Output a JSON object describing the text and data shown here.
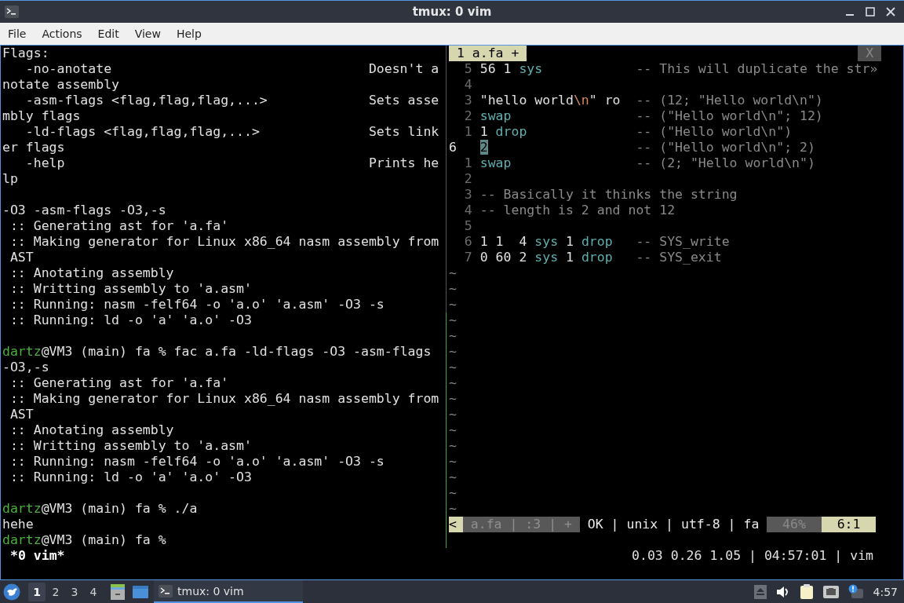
{
  "window": {
    "title": "tmux: 0 vim"
  },
  "menu": [
    "File",
    "Actions",
    "Edit",
    "View",
    "Help"
  ],
  "left_pane": {
    "lines": [
      {
        "kind": "text",
        "text": "Flags:"
      },
      {
        "kind": "help",
        "option": "   -no-anotate",
        "description": "Doesn't a"
      },
      {
        "kind": "text",
        "text": "notate assembly"
      },
      {
        "kind": "help",
        "option": "   -asm-flags <flag,flag,flag,...>",
        "description": "Sets asse"
      },
      {
        "kind": "text",
        "text": "mbly flags"
      },
      {
        "kind": "help",
        "option": "   -ld-flags <flag,flag,flag,...>",
        "description": "Sets link"
      },
      {
        "kind": "text",
        "text": "er flags"
      },
      {
        "kind": "help",
        "option": "   -help",
        "description": "Prints he"
      },
      {
        "kind": "text",
        "text": "lp"
      },
      {
        "kind": "blank"
      },
      {
        "kind": "text",
        "text": "-O3 -asm-flags -O3,-s"
      },
      {
        "kind": "text",
        "text": " :: Generating ast for 'a.fa'"
      },
      {
        "kind": "text",
        "text": " :: Making generator for Linux x86_64 nasm assembly from"
      },
      {
        "kind": "text",
        "text": " AST"
      },
      {
        "kind": "text",
        "text": " :: Anotating assembly"
      },
      {
        "kind": "text",
        "text": " :: Writting assembly to 'a.asm'"
      },
      {
        "kind": "text",
        "text": " :: Running: nasm -felf64 -o 'a.o' 'a.asm' -O3 -s"
      },
      {
        "kind": "text",
        "text": " :: Running: ld -o 'a' 'a.o' -O3"
      },
      {
        "kind": "blank"
      },
      {
        "kind": "prompt",
        "user": "dartz",
        "prompt": "@VM3 (main) fa %",
        "command": "fac a.fa -ld-flags -O3 -asm-flags"
      },
      {
        "kind": "text",
        "text": "-O3,-s"
      },
      {
        "kind": "text",
        "text": " :: Generating ast for 'a.fa'"
      },
      {
        "kind": "text",
        "text": " :: Making generator for Linux x86_64 nasm assembly from"
      },
      {
        "kind": "text",
        "text": " AST"
      },
      {
        "kind": "text",
        "text": " :: Anotating assembly"
      },
      {
        "kind": "text",
        "text": " :: Writting assembly to 'a.asm'"
      },
      {
        "kind": "text",
        "text": " :: Running: nasm -felf64 -o 'a.o' 'a.asm' -O3 -s"
      },
      {
        "kind": "text",
        "text": " :: Running: ld -o 'a' 'a.o' -O3"
      },
      {
        "kind": "blank"
      },
      {
        "kind": "prompt",
        "user": "dartz",
        "prompt": "@VM3 (main) fa %",
        "command": "./a"
      },
      {
        "kind": "text",
        "text": "hehe"
      },
      {
        "kind": "prompt",
        "user": "dartz",
        "prompt": "@VM3 (main) fa %"
      }
    ]
  },
  "vim": {
    "tab": "1 a.fa +",
    "close": "X",
    "lines": [
      {
        "number": "5",
        "current": false,
        "tokens": [
          {
            "kind": "plain",
            "text": "56 1 "
          },
          {
            "kind": "keyword",
            "text": "sys"
          }
        ],
        "comment": "-- This will duplicate the str»"
      },
      {
        "number": "4",
        "current": false
      },
      {
        "number": "3",
        "current": false,
        "tokens": [
          {
            "kind": "plain",
            "text": "\"hello world"
          },
          {
            "kind": "escape",
            "text": "\\n"
          },
          {
            "kind": "plain",
            "text": "\" ro"
          }
        ],
        "comment": "-- (12; \"Hello world\\n\")"
      },
      {
        "number": "2",
        "current": false,
        "tokens": [
          {
            "kind": "keyword",
            "text": "swap"
          }
        ],
        "comment": "-- (\"Hello world\\n\"; 12)"
      },
      {
        "number": "1",
        "current": false,
        "tokens": [
          {
            "kind": "plain",
            "text": "1 "
          },
          {
            "kind": "keyword",
            "text": "drop"
          }
        ],
        "comment": "-- (\"Hello world\\n\")"
      },
      {
        "number": "6",
        "current": true,
        "tokens": [
          {
            "kind": "cursor",
            "text": "2"
          }
        ],
        "comment": "-- (\"Hello world\\n\"; 2)"
      },
      {
        "number": "1",
        "current": false,
        "tokens": [
          {
            "kind": "keyword",
            "text": "swap"
          }
        ],
        "comment": "-- (2; \"Hello world\\n\")"
      },
      {
        "number": "2",
        "current": false
      },
      {
        "number": "3",
        "current": false,
        "tokens": [
          {
            "kind": "comment",
            "text": "-- Basically it thinks the string"
          }
        ]
      },
      {
        "number": "4",
        "current": false,
        "tokens": [
          {
            "kind": "comment",
            "text": "-- length is 2 and not 12"
          }
        ]
      },
      {
        "number": "5",
        "current": false
      },
      {
        "number": "6",
        "current": false,
        "tokens": [
          {
            "kind": "plain",
            "text": "1 1  4 "
          },
          {
            "kind": "keyword",
            "text": "sys"
          },
          {
            "kind": "plain",
            "text": " 1 "
          },
          {
            "kind": "keyword",
            "text": "drop"
          }
        ],
        "comment": "-- SYS_write"
      },
      {
        "number": "7",
        "current": false,
        "tokens": [
          {
            "kind": "plain",
            "text": "0 60 2 "
          },
          {
            "kind": "keyword",
            "text": "sys"
          },
          {
            "kind": "plain",
            "text": " 1 "
          },
          {
            "kind": "keyword",
            "text": "drop"
          }
        ],
        "comment": "-- SYS_exit"
      }
    ],
    "filler": [
      "~",
      "~",
      "~",
      "~",
      "~",
      "~",
      "~",
      "~",
      "~",
      "~",
      "~",
      "~",
      "~",
      "~",
      "~",
      "~"
    ],
    "statusline": [
      {
        "kind": "mode",
        "text": "<"
      },
      {
        "kind": "file",
        "text": "a.fa | :3 | +"
      },
      {
        "kind": "info",
        "text": "OK | unix | utf-8 | fa"
      },
      {
        "kind": "percent",
        "text": "46%"
      },
      {
        "kind": "position",
        "text": "6:1"
      }
    ]
  },
  "tmux_status": {
    "windows": "*0 vim*",
    "right": "0.03 0.26 1.05 | 04:57:01 | vim"
  },
  "taskbar": {
    "workspaces": [
      {
        "label": "1",
        "selected": true
      },
      {
        "label": "2",
        "selected": false
      },
      {
        "label": "3",
        "selected": false
      },
      {
        "label": "4",
        "selected": false
      }
    ],
    "task": {
      "label": "tmux: 0 vim",
      "selected": true
    },
    "clock": "4:57"
  }
}
